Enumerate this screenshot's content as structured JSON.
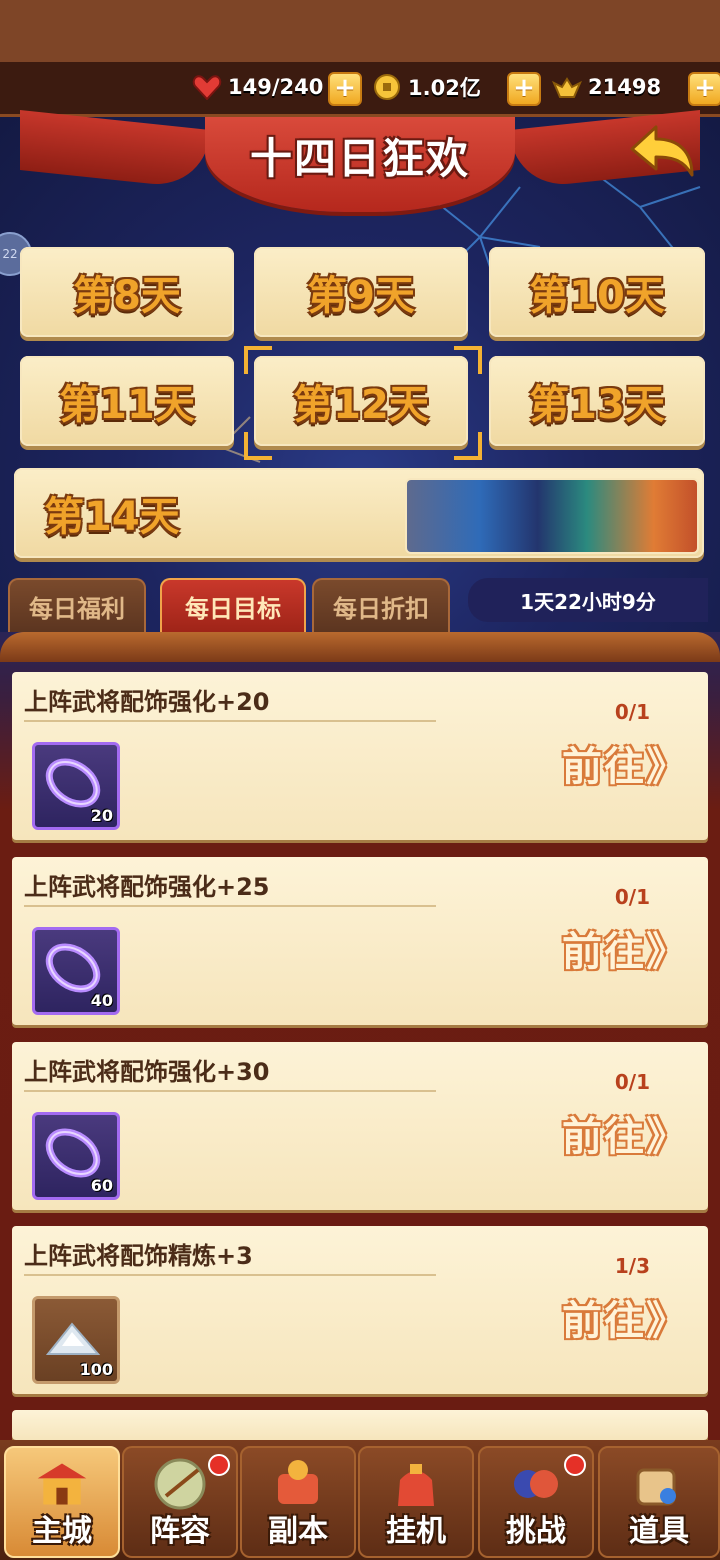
{
  "currencies": {
    "stamina": "149/240",
    "coins": "1.02亿",
    "ingots": "21498",
    "plus": "+"
  },
  "event": {
    "title": "十四日狂欢",
    "days": [
      "第8天",
      "第9天",
      "第10天",
      "第11天",
      "第12天",
      "第13天",
      "第14天"
    ],
    "selected_day": "第12天"
  },
  "tabs": {
    "items": [
      "每日福利",
      "每日目标",
      "每日折扣"
    ],
    "active": "每日目标",
    "timer": "1天22小时9分"
  },
  "tasks": [
    {
      "title": "上阵武将配饰强化+20",
      "progress": "0/1",
      "item_count": "20",
      "go": "前往》"
    },
    {
      "title": "上阵武将配饰强化+25",
      "progress": "0/1",
      "item_count": "40",
      "go": "前往》"
    },
    {
      "title": "上阵武将配饰强化+30",
      "progress": "0/1",
      "item_count": "60",
      "go": "前往》"
    },
    {
      "title": "上阵武将配饰精炼+3",
      "progress": "1/3",
      "item_count": "100",
      "go": "前往》"
    }
  ],
  "nav": [
    {
      "label": "主城"
    },
    {
      "label": "阵容"
    },
    {
      "label": "副本"
    },
    {
      "label": "挂机"
    },
    {
      "label": "挑战"
    },
    {
      "label": "道具"
    }
  ],
  "side_handle": "22",
  "colors": {
    "accent_gold": "#f0a32a",
    "title_red": "#c9382b",
    "go_orange": "#d97a3a"
  }
}
